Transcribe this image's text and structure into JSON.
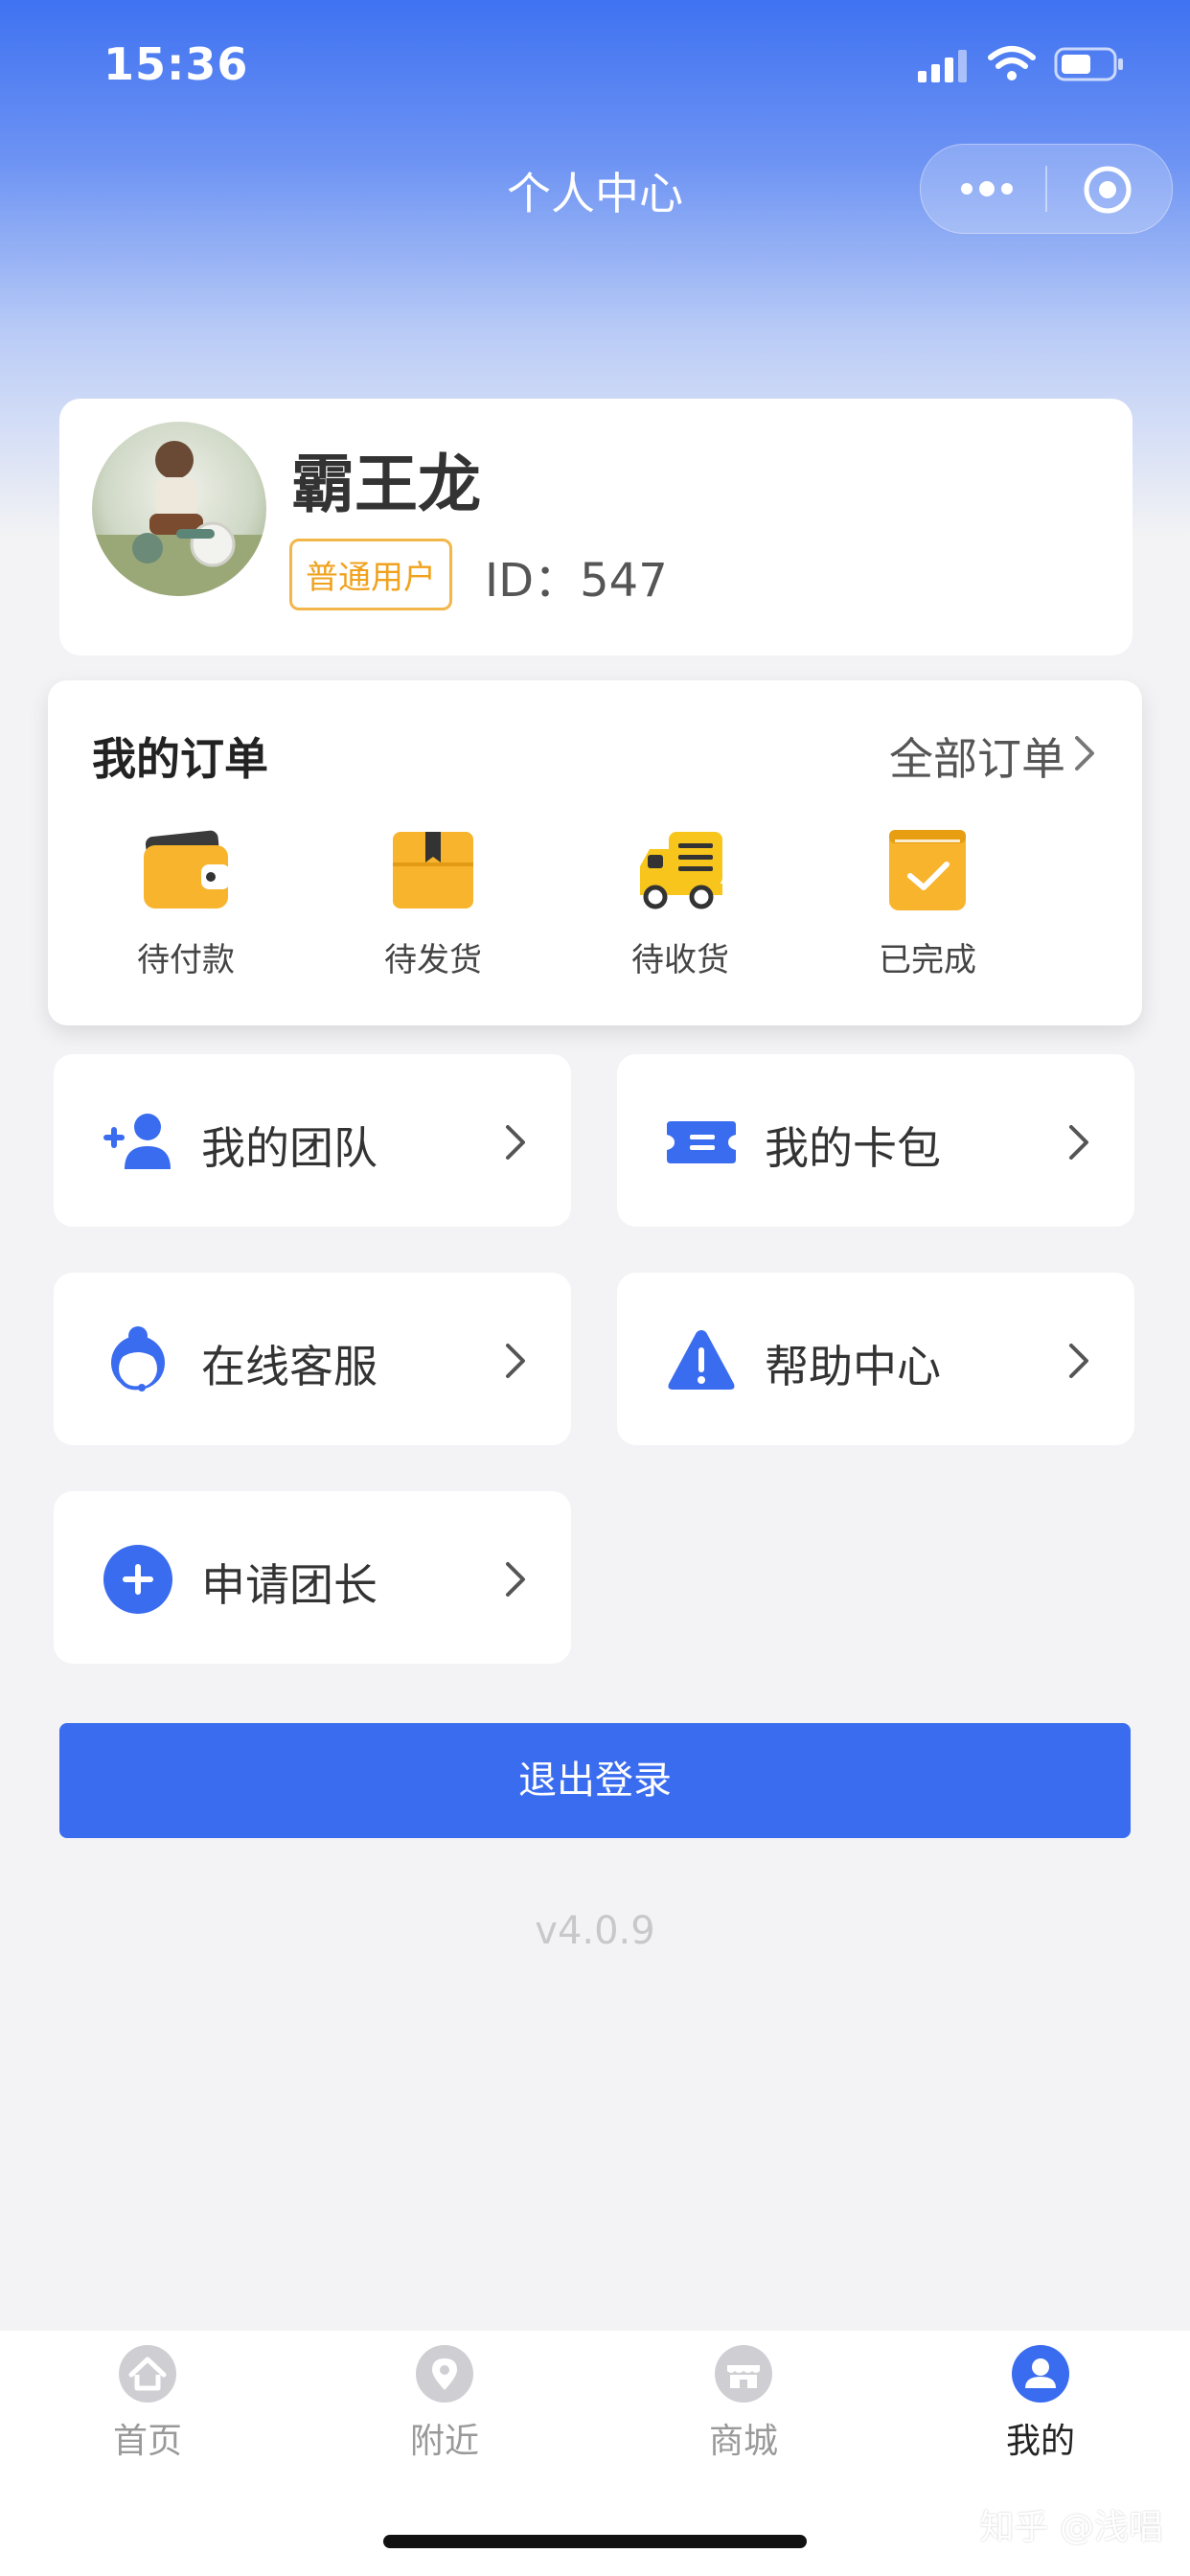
{
  "status_bar": {
    "time": "15:36"
  },
  "nav": {
    "title": "个人中心"
  },
  "profile": {
    "name": "霸王龙",
    "tag": "普通用户",
    "id_text": "ID：547"
  },
  "orders": {
    "title": "我的订单",
    "all_label": "全部订单",
    "items": [
      {
        "label": "待付款",
        "icon": "wallet-icon"
      },
      {
        "label": "待发货",
        "icon": "package-icon"
      },
      {
        "label": "待收货",
        "icon": "delivery-truck-icon"
      },
      {
        "label": "已完成",
        "icon": "completed-check-icon"
      }
    ]
  },
  "menu": [
    {
      "label": "我的团队",
      "icon": "add-user-icon"
    },
    {
      "label": "我的卡包",
      "icon": "card-ticket-icon"
    },
    {
      "label": "在线客服",
      "icon": "customer-service-icon"
    },
    {
      "label": "帮助中心",
      "icon": "warning-icon"
    },
    {
      "label": "申请团长",
      "icon": "plus-circle-icon"
    }
  ],
  "logout_label": "退出登录",
  "version": "v4.0.9",
  "tabbar": [
    {
      "label": "首页",
      "icon": "home-icon",
      "active": false
    },
    {
      "label": "附近",
      "icon": "location-icon",
      "active": false
    },
    {
      "label": "商城",
      "icon": "store-icon",
      "active": false
    },
    {
      "label": "我的",
      "icon": "profile-icon",
      "active": true
    }
  ],
  "watermark": "知乎 @浅唱",
  "colors": {
    "primary": "#3a6cf0",
    "accent_yellow": "#f7b42c",
    "tag_orange": "#f0a21d"
  }
}
